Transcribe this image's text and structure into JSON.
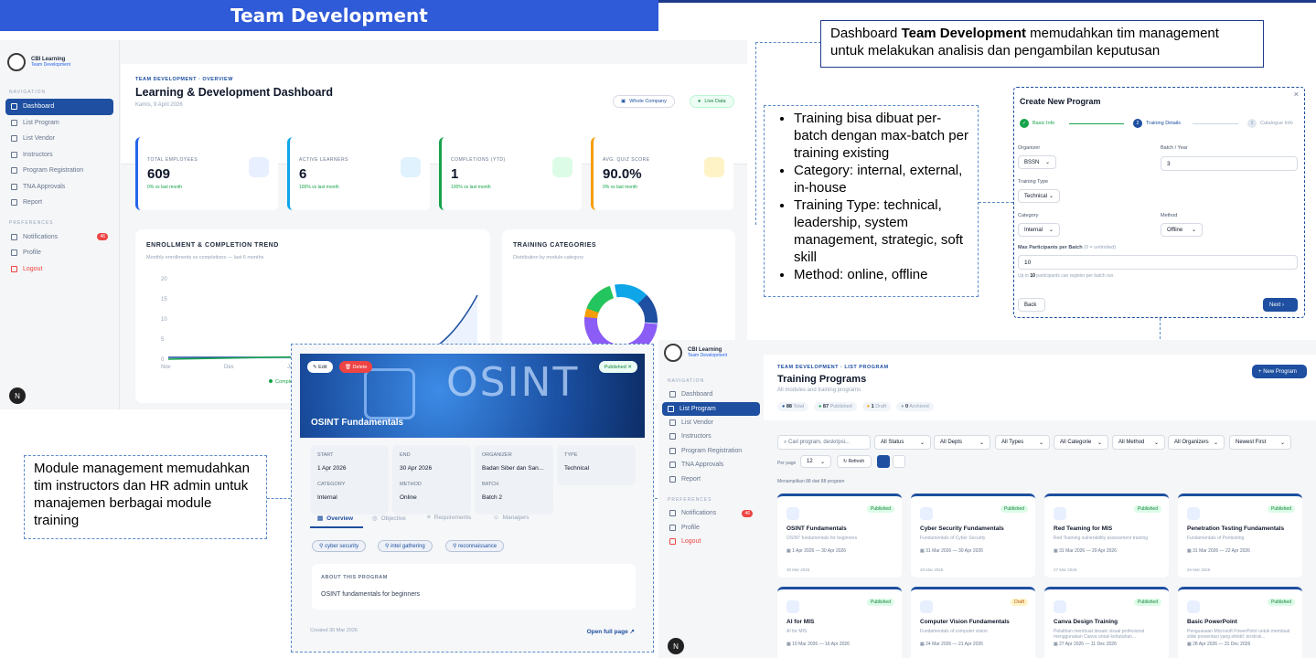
{
  "banner": "Team Development",
  "callout_top": {
    "pre": "Dashboard ",
    "bold": "Team Development",
    "post": " memudahkan tim management untuk melakukan analisis dan pengambilan keputusan"
  },
  "callout_bullets": [
    "Training bisa dibuat per-batch dengan max-batch per training existing",
    "Category: internal, external, in-house",
    "Training Type: technical, leadership, system management, strategic, soft skill",
    "Method: online, offline"
  ],
  "callout_bottom": "Module management memudahkan tim instructors dan HR admin untuk manajemen berbagai module training",
  "app": {
    "name": "CBI Learning",
    "sub": "Team Development"
  },
  "sidebar": {
    "nav_label": "NAVIGATION",
    "pref_label": "PREFERENCES",
    "items": [
      "Dashboard",
      "List Program",
      "List Vendor",
      "Instructors",
      "Program Registration",
      "TNA Approvals",
      "Report"
    ],
    "prefs": [
      "Notifications",
      "Profile",
      "Logout"
    ],
    "notif_count": "46"
  },
  "dashboard": {
    "crumb": "TEAM DEVELOPMENT · OVERVIEW",
    "title": "Learning & Development Dashboard",
    "date": "Kamis, 9 April 2026",
    "scope": "Whole Company",
    "live": "Live Data",
    "kpis": [
      {
        "label": "TOTAL EMPLOYEES",
        "value": "609",
        "delta": "0% vs last month"
      },
      {
        "label": "ACTIVE LEARNERS",
        "value": "6",
        "delta": "100% vs last month"
      },
      {
        "label": "COMPLETIONS (YTD)",
        "value": "1",
        "delta": "100% vs last month"
      },
      {
        "label": "AVG. QUIZ SCORE",
        "value": "90.0%",
        "delta": "0% vs last month"
      }
    ],
    "trend": {
      "title": "ENROLLMENT & COMPLETION TREND",
      "sub": "Monthly enrollments vs completions — last 6 months",
      "legend": "Completions",
      "yticks": [
        "20",
        "15",
        "10",
        "5",
        "0"
      ],
      "xticks": [
        "Nov",
        "Des",
        "Jan"
      ]
    },
    "cats": {
      "title": "TRAINING CATEGORIES",
      "sub": "Distribution by module category"
    }
  },
  "create": {
    "title": "Create New Program",
    "steps": [
      "Basic Info",
      "Training Details",
      "Catalogue Info"
    ],
    "step_num": [
      "2",
      "3"
    ],
    "organizer_label": "Organizer",
    "organizer": "BSSN",
    "batch_label": "Batch / Year",
    "batch": "3",
    "type_label": "Training Type",
    "type": "Technical",
    "category_label": "Category",
    "category": "Internal",
    "method_label": "Method",
    "method": "Offline",
    "max_label": "Max Participants per Batch",
    "max_hint": "(0 = unlimited)",
    "max": "10",
    "note_pre": "Up to ",
    "note_num": "10",
    "note_post": " participants can register per batch run.",
    "back": "Back",
    "next": "Next"
  },
  "list": {
    "crumb": "TEAM DEVELOPMENT · LIST PROGRAM",
    "title": "Training Programs",
    "sub": "All modules and training programs",
    "new_btn": "New Program",
    "stats": [
      {
        "n": "88",
        "l": "Total"
      },
      {
        "n": "87",
        "l": "Published"
      },
      {
        "n": "1",
        "l": "Draft"
      },
      {
        "n": "0",
        "l": "Archived"
      }
    ],
    "search": "Cari program, deskripsi...",
    "filters": [
      "All Status",
      "All Depts",
      "All Types",
      "All Categorie",
      "All Method",
      "All Organizers",
      "Newest First"
    ],
    "per_page_label": "Per page",
    "per_page": "12",
    "refresh": "Refresh",
    "showing": "Menampilkan 88 dari 88 program",
    "cards": [
      {
        "t": "OSINT Fundamentals",
        "s": "OSINT fundamentals for beginners",
        "d1": "1 Apr 2026",
        "d2": "30 Apr 2026",
        "c": "30 Mar 2026",
        "st": "Published"
      },
      {
        "t": "Cyber Security Fundamentals",
        "s": "Fundamentals of Cyber Security",
        "d1": "31 Mar 2026",
        "d2": "30 Apr 2026",
        "c": "28 Mar 2026",
        "st": "Published"
      },
      {
        "t": "Red Teaming for MIS",
        "s": "Red Teaming vulnerability assessment training",
        "d1": "31 Mar 2026",
        "d2": "29 Apr 2026",
        "c": "27 Mar 2026",
        "st": "Published"
      },
      {
        "t": "Penetration Testing Fundamentals",
        "s": "Fundamentals of Pentesting",
        "d1": "31 Mar 2026",
        "d2": "22 Apr 2026",
        "c": "26 Mar 2026",
        "st": "Published"
      },
      {
        "t": "AI for MIS",
        "s": "AI for MIS",
        "d1": "19 Mar 2026",
        "d2": "16 Apr 2026",
        "c": "",
        "st": "Published"
      },
      {
        "t": "Computer Vision Fundamentals",
        "s": "Fundamentals of computer vision",
        "d1": "24 Mar 2026",
        "d2": "21 Apr 2026",
        "c": "",
        "st": "Draft"
      },
      {
        "t": "Canva Design Training",
        "s": "Pelatihan membuat desain visual profesional menggunakan Canva untuk kebutuhan...",
        "d1": "27 Apr 2026",
        "d2": "11 Dec 2026",
        "c": "",
        "st": "Published"
      },
      {
        "t": "Basic PowerPoint",
        "s": "Penguasaan Microsoft PowerPoint untuk membuat slide presentasi yang efektif, terstruk...",
        "d1": "28 Apr 2026",
        "d2": "31 Dec 2026",
        "c": "",
        "st": "Published"
      }
    ]
  },
  "detail": {
    "edit": "Edit",
    "delete": "Delete",
    "status": "Published",
    "img_text": "OSINT",
    "title": "OSINT Fundamentals",
    "chips": [
      {
        "l": "START",
        "v": "1 Apr 2026"
      },
      {
        "l": "END",
        "v": "30 Apr 2026"
      },
      {
        "l": "ORGANIZER",
        "v": "Badan Siber dan San..."
      },
      {
        "l": "TYPE",
        "v": "Technical"
      },
      {
        "l": "CATEGORY",
        "v": "Internal"
      },
      {
        "l": "METHOD",
        "v": "Online"
      },
      {
        "l": "BATCH",
        "v": "Batch 2"
      }
    ],
    "tabs": [
      "Overview",
      "Objective",
      "Requirements",
      "Managers"
    ],
    "tags": [
      "cyber security",
      "intel gathering",
      "reconnaissance"
    ],
    "about_label": "ABOUT THIS PROGRAM",
    "about": "OSINT fundamentals for beginners",
    "created": "Created 30 Mar 2026",
    "open": "Open full page"
  },
  "colors": {
    "primary": "#1e4fa0",
    "banner": "#2f5ad8",
    "published": "#16a34a",
    "draft": "#f59e0b",
    "danger": "#ef4444"
  }
}
